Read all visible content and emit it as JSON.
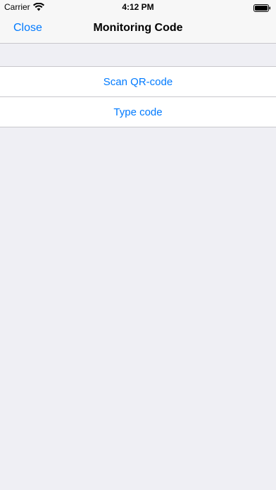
{
  "status_bar": {
    "carrier": "Carrier",
    "time": "4:12 PM",
    "wifi_icon": "wifi-icon",
    "battery_icon": "battery-icon"
  },
  "nav_bar": {
    "close_label": "Close",
    "title": "Monitoring Code"
  },
  "options": [
    {
      "label": "Scan QR-code"
    },
    {
      "label": "Type code"
    }
  ],
  "colors": {
    "accent": "#007aff",
    "background": "#efeff4",
    "cell_background": "#ffffff",
    "separator": "#c8c7cc"
  }
}
